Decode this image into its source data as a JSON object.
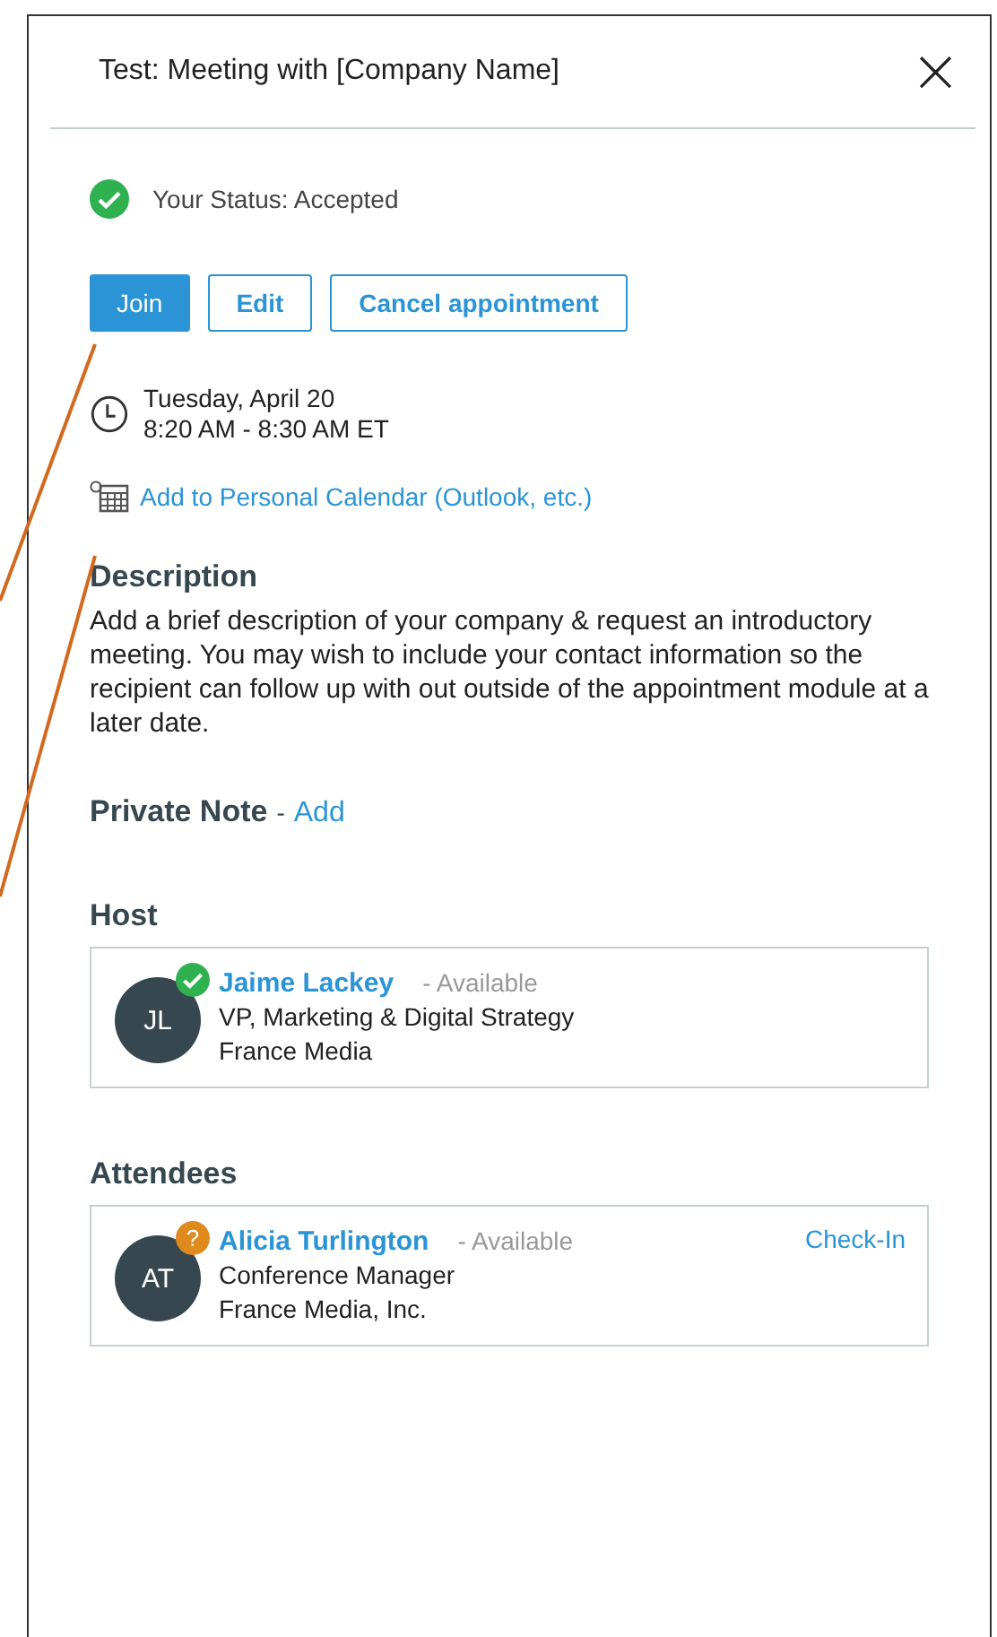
{
  "dialog": {
    "title": "Test: Meeting with [Company Name]",
    "close": "×"
  },
  "status": {
    "text": "Your Status: Accepted",
    "accepted": true
  },
  "buttons": [
    {
      "label": "Join",
      "kind": "primary"
    },
    {
      "label": "Edit",
      "kind": "outline"
    },
    {
      "label": "Cancel appointment",
      "kind": "outline"
    }
  ],
  "when": {
    "date": "Tuesday, April 20",
    "time": "8:20 AM - 8:30 AM ET"
  },
  "calendar_link": "Add to Personal Calendar (Outlook, etc.)",
  "description": {
    "heading": "Description",
    "text": "Add a brief description of your company & request an introductory meeting. You may wish to include your contact information so the recipient can follow up with out outside of the appointment module at a later date."
  },
  "private_note": {
    "heading": "Private Note",
    "separator": "-",
    "link": "Add"
  },
  "host": {
    "heading": "Host",
    "people": [
      {
        "initials": "JL",
        "accepted": true,
        "name": "Jaime Lackey",
        "availability": "- Available",
        "title": "VP, Marketing & Digital Strategy",
        "company": "France Media"
      }
    ]
  },
  "attendees": {
    "heading": "Attendees",
    "people": [
      {
        "initials": "AT",
        "accepted": false,
        "status_mark": "?",
        "name": "Alicia Turlington",
        "availability": "- Available",
        "title": "Conference Manager",
        "company": "France Media, Inc.",
        "action": "Check-In"
      }
    ]
  }
}
